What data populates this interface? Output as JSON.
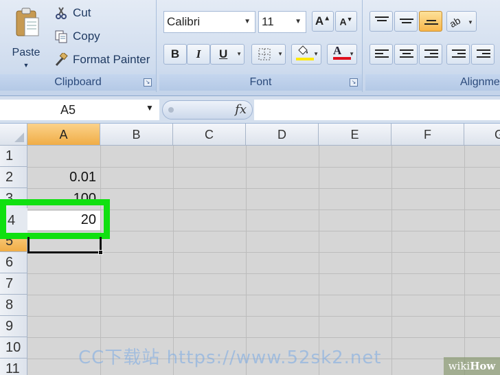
{
  "ribbon": {
    "clipboard": {
      "paste_label": "Paste",
      "cut_label": "Cut",
      "copy_label": "Copy",
      "format_painter_label": "Format Painter",
      "group_label": "Clipboard"
    },
    "font": {
      "font_name": "Calibri",
      "font_size": "11",
      "bold": "B",
      "italic": "I",
      "underline": "U",
      "font_color_glyph": "A",
      "group_label": "Font",
      "fill_color": "#ffe800",
      "font_color": "#e0101e"
    },
    "alignment": {
      "group_label": "Alignme"
    }
  },
  "formula_bar": {
    "name_box": "A5",
    "fx": "fx",
    "formula": ""
  },
  "grid": {
    "columns": [
      "A",
      "B",
      "C",
      "D",
      "E",
      "F",
      "G"
    ],
    "selected_column": "A",
    "rows": [
      "1",
      "2",
      "3",
      "4",
      "5",
      "6",
      "7",
      "8",
      "9",
      "10",
      "11"
    ],
    "selected_row": "5",
    "cells": {
      "A2": "0.01",
      "A3": "100",
      "A4": "20"
    },
    "highlight_color": "#10e010"
  },
  "watermarks": {
    "site": "CC下载站 https://www.52sk2.net",
    "wikihow_wiki": "wiki",
    "wikihow_how": "How"
  }
}
